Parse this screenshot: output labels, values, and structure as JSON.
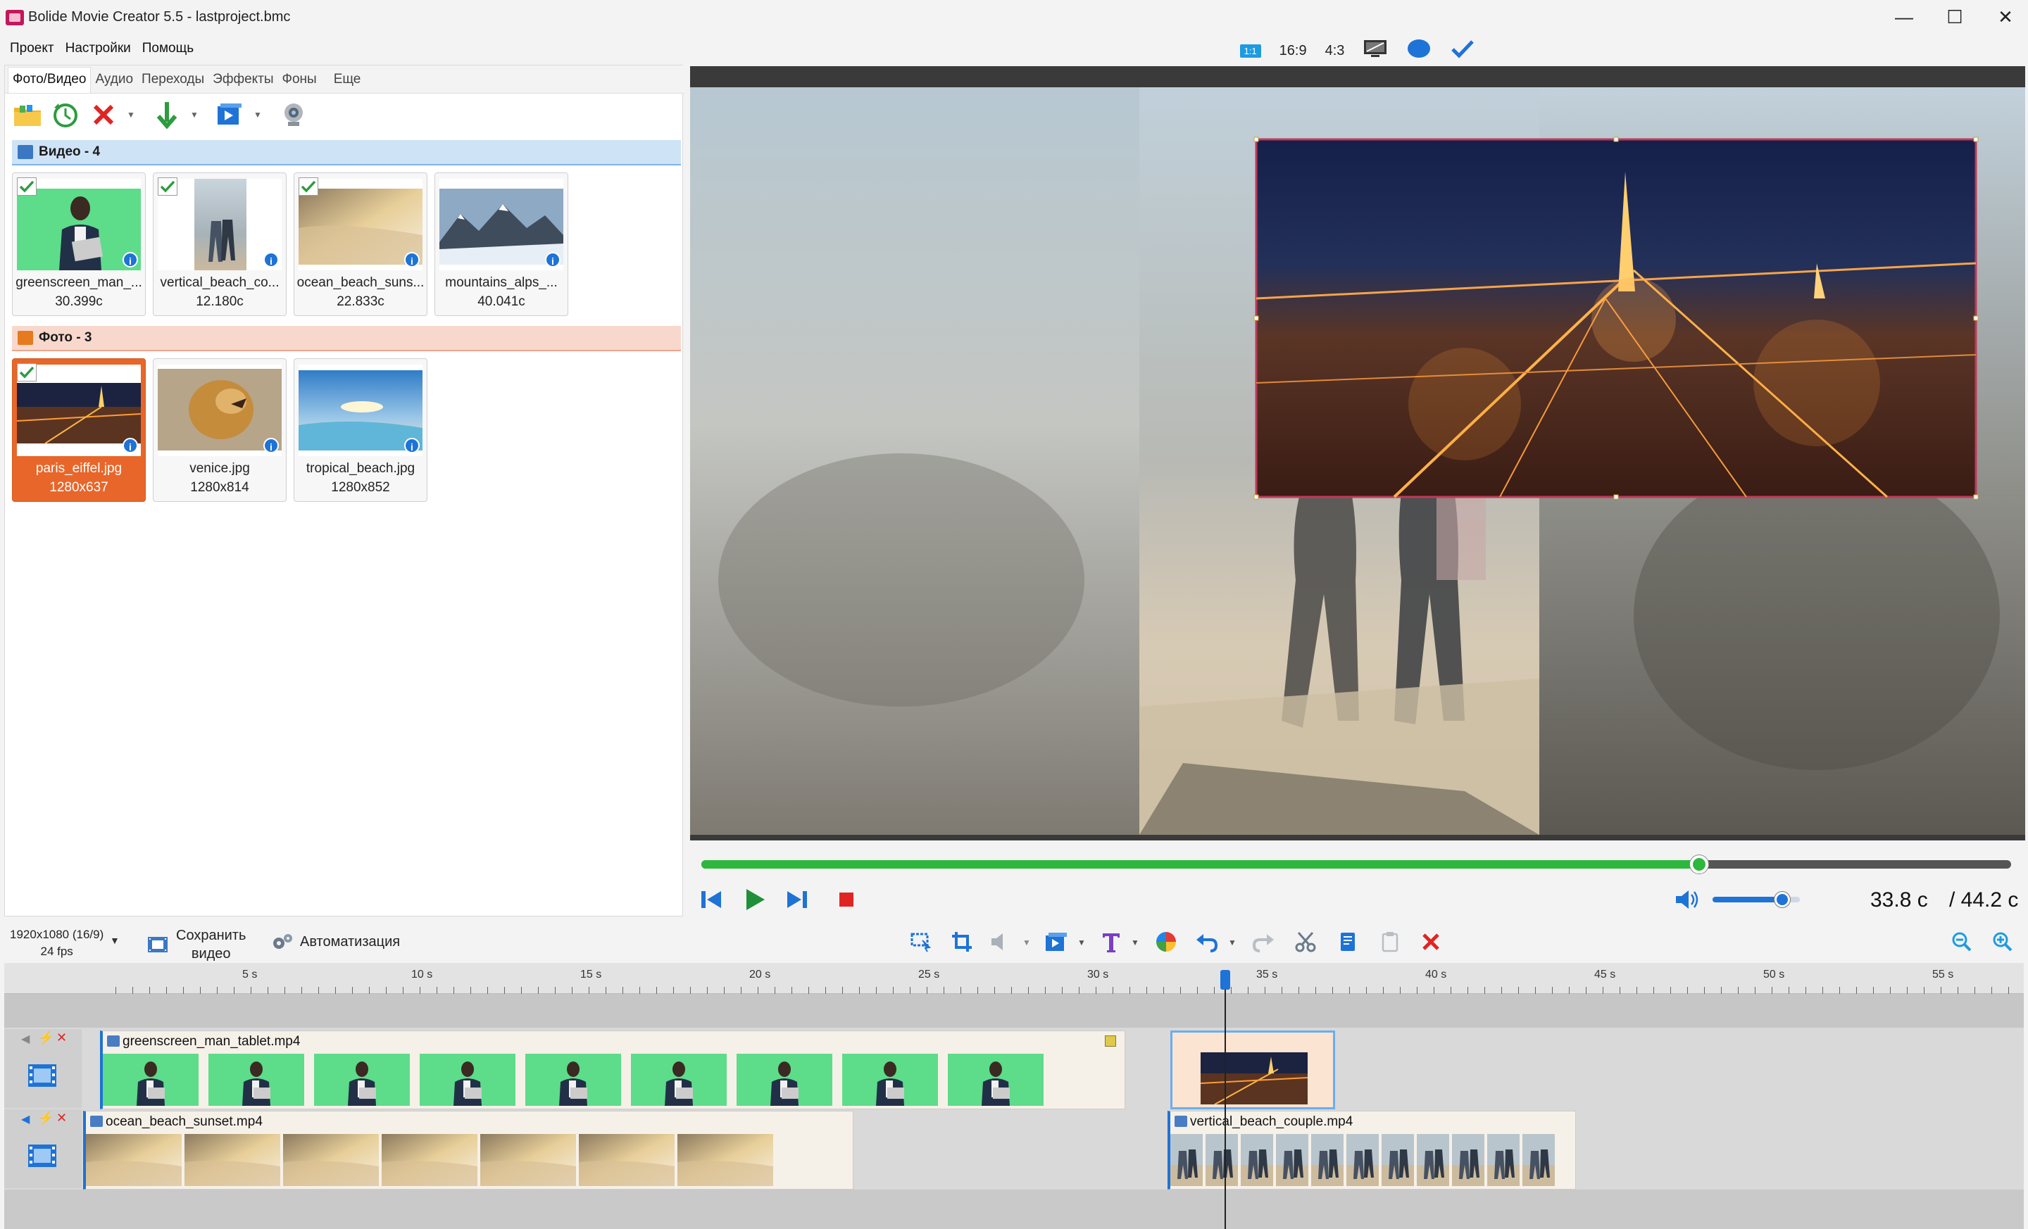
{
  "window": {
    "title": "Bolide Movie Creator 5.5 - lastproject.bmc",
    "controls": [
      "minimize-icon",
      "maximize-icon",
      "close-icon"
    ]
  },
  "menu": [
    "Проект",
    "Настройки",
    "Помощь"
  ],
  "tabs": [
    "Фото/Видео",
    "Аудио",
    "Переходы",
    "Эффекты",
    "Фоны",
    "Еще"
  ],
  "groups": {
    "video": {
      "label": "Видео - 4",
      "items": [
        {
          "name": "greenscreen_man_...",
          "meta": "30.399с",
          "checked": true
        },
        {
          "name": "vertical_beach_co...",
          "meta": "12.180с",
          "checked": true
        },
        {
          "name": "ocean_beach_suns...",
          "meta": "22.833с",
          "checked": true
        },
        {
          "name": "mountains_alps_...",
          "meta": "40.041с",
          "checked": false
        }
      ]
    },
    "photo": {
      "label": "Фото - 3",
      "items": [
        {
          "name": "paris_eiffel.jpg",
          "meta": "1280x637",
          "checked": true,
          "selected": true
        },
        {
          "name": "venice.jpg",
          "meta": "1280x814",
          "checked": false
        },
        {
          "name": "tropical_beach.jpg",
          "meta": "1280x852",
          "checked": false
        }
      ]
    }
  },
  "preview": {
    "aspect_options": [
      "16:9",
      "4:3"
    ],
    "aspect_badge": "1:1",
    "progress_fraction": 0.762,
    "volume_fraction": 0.8,
    "time_current": "33.8 с",
    "time_total": "/ 44.2 с"
  },
  "bottom": {
    "resolution": "1920x1080 (16/9)",
    "fps": "24 fps",
    "save_label_1": "Сохранить",
    "save_label_2": "видео",
    "automation_label": "Автоматизация"
  },
  "timeline": {
    "ruler_labels": [
      "5 s",
      "10 s",
      "15 s",
      "20 s",
      "25 s",
      "30 s",
      "35 s",
      "40 s",
      "45 s",
      "50 s",
      "55 s"
    ],
    "clips": {
      "track1_a": "greenscreen_man_tablet.mp4",
      "track2_a": "ocean_beach_sunset.mp4",
      "track2_b": "vertical_beach_couple.mp4"
    }
  },
  "colors": {
    "accent": "#1e73d6",
    "progress": "#2db83d",
    "selected_card": "#e8662a",
    "video_group": "#cfe3f7",
    "photo_group": "#f8d8cc"
  }
}
